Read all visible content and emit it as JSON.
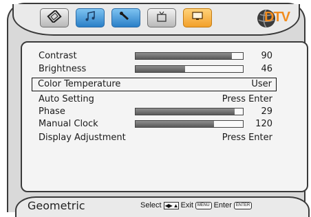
{
  "header": {
    "tabs": [
      {
        "name": "picture",
        "icon": "picture-icon"
      },
      {
        "name": "sound",
        "icon": "music-icon"
      },
      {
        "name": "setup",
        "icon": "wrench-icon"
      },
      {
        "name": "tv",
        "icon": "tv-icon"
      },
      {
        "name": "display",
        "icon": "monitor-icon"
      }
    ],
    "logo_text": "DTV"
  },
  "menu": {
    "items": [
      {
        "label": "Contrast",
        "value": "90",
        "level": 0.9
      },
      {
        "label": "Brightness",
        "value": "46",
        "level": 0.46
      },
      {
        "label": "Color Temperature",
        "value": "User"
      },
      {
        "label": "Auto Setting",
        "value": "Press Enter"
      },
      {
        "label": "Phase",
        "value": "29",
        "level": 0.92
      },
      {
        "label": "Manual Clock",
        "value": "120",
        "level": 0.73
      },
      {
        "label": "Display Adjustment",
        "value": "Press Enter"
      }
    ],
    "selected_index": 2
  },
  "footer": {
    "title": "Geometric",
    "select_label": "Select",
    "exit_label": "Exit",
    "enter_label": "Enter",
    "menu_key": "MENU",
    "enter_key": "ENTER"
  },
  "colors": {
    "accent_blue": "#2a7fc7",
    "accent_orange": "#f2a02a",
    "logo_orange": "#f28c1e"
  }
}
